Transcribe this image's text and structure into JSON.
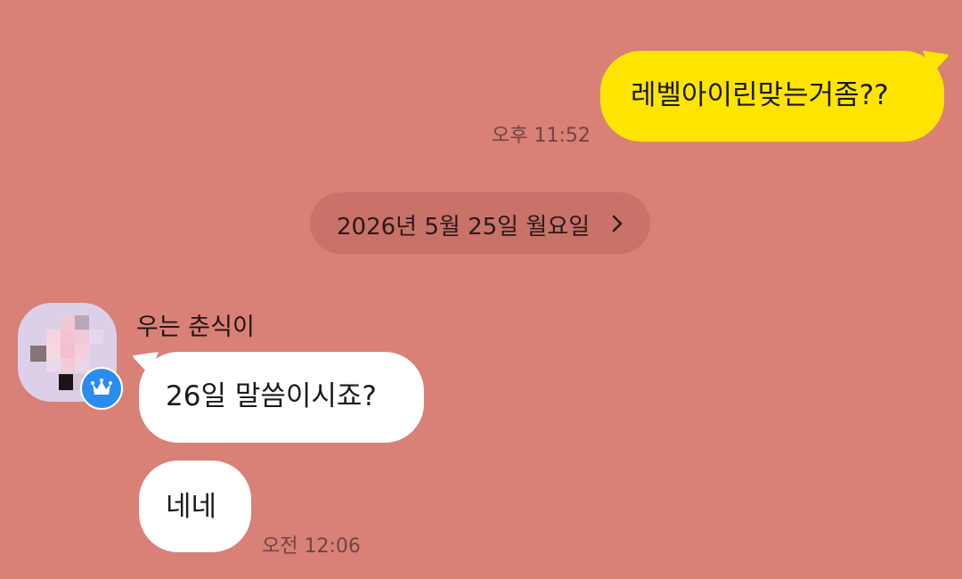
{
  "chat": {
    "date_separator": "2026년 5월 25일 월요일",
    "messages": [
      {
        "direction": "sent",
        "text": "레벨아이린맞는거좀??",
        "time": "오후 11:52"
      },
      {
        "direction": "received",
        "sender": "우는 춘식이",
        "text": "26일 말씀이시죠?"
      },
      {
        "direction": "received",
        "text": "네네",
        "time": "오전 12:06"
      }
    ]
  },
  "colors": {
    "background": "#d98077",
    "sent_bubble": "#fee500",
    "received_bubble": "#ffffff",
    "badge": "#2b8cf0"
  },
  "icons": {
    "date_chevron": "chevron-right-icon",
    "badge": "crown-icon"
  }
}
